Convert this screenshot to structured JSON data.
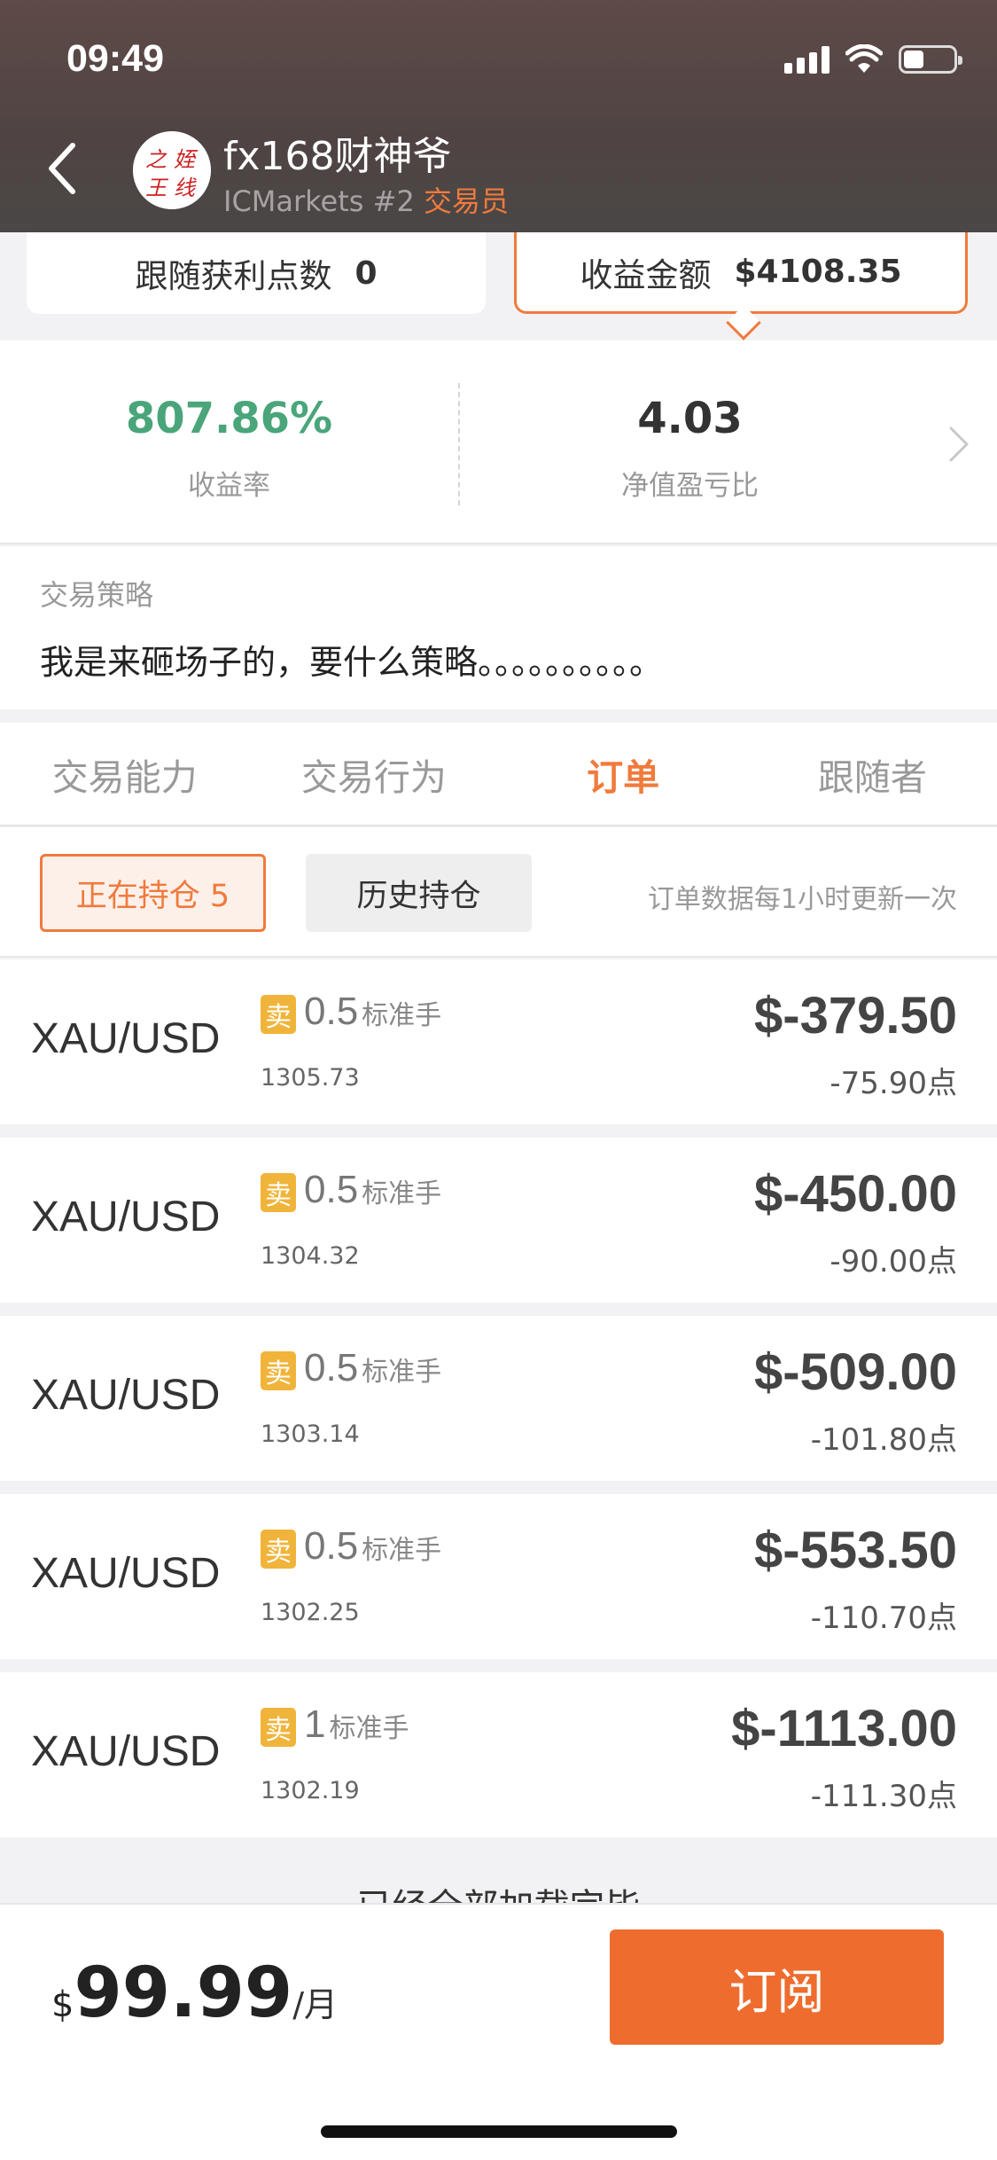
{
  "status_bar": {
    "time": "09:49"
  },
  "header": {
    "trader_name": "fx168财神爷",
    "broker": "ICMarkets #2",
    "role": "交易员",
    "avatar_text": "之 姪 王 线"
  },
  "summary": {
    "left_label": "跟随获利点数",
    "left_value": "0",
    "right_label": "收益金额",
    "right_value": "$4108.35"
  },
  "stats": [
    {
      "value": "807.86%",
      "label": "收益率"
    },
    {
      "value": "4.03",
      "label": "净值盈亏比"
    }
  ],
  "strategy": {
    "title": "交易策略",
    "text": "我是来砸场子的，要什么策略。。。。。。。。。。"
  },
  "tabs": [
    {
      "label": "交易能力",
      "active": false
    },
    {
      "label": "交易行为",
      "active": false
    },
    {
      "label": "订单",
      "active": true
    },
    {
      "label": "跟随者",
      "active": false
    }
  ],
  "filters": {
    "open_label": "正在持仓 5",
    "history_label": "历史持仓",
    "update_note": "订单数据每1小时更新一次"
  },
  "orders": [
    {
      "symbol": "XAU/USD",
      "side": "卖",
      "lots": "0.5",
      "unit": "标准手",
      "price": "1305.73",
      "pnl": "$-379.50",
      "points": "-75.90点"
    },
    {
      "symbol": "XAU/USD",
      "side": "卖",
      "lots": "0.5",
      "unit": "标准手",
      "price": "1304.32",
      "pnl": "$-450.00",
      "points": "-90.00点"
    },
    {
      "symbol": "XAU/USD",
      "side": "卖",
      "lots": "0.5",
      "unit": "标准手",
      "price": "1303.14",
      "pnl": "$-509.00",
      "points": "-101.80点"
    },
    {
      "symbol": "XAU/USD",
      "side": "卖",
      "lots": "0.5",
      "unit": "标准手",
      "price": "1302.25",
      "pnl": "$-553.50",
      "points": "-110.70点"
    },
    {
      "symbol": "XAU/USD",
      "side": "卖",
      "lots": "1",
      "unit": "标准手",
      "price": "1302.19",
      "pnl": "$-1113.00",
      "points": "-111.30点"
    }
  ],
  "loaded_hint": "已经全部加载完毕",
  "subscription": {
    "currency": "$",
    "amount": "99.99",
    "period": "/月",
    "button_label": "订阅"
  },
  "colors": {
    "accent": "#f07a3c",
    "gain_green": "#4aa57a",
    "sell_badge": "#f0b43a"
  },
  "icons": {
    "back": "chevron-left-icon",
    "stats_more": "chevron-right-icon",
    "signal": "cellular-signal-icon",
    "wifi": "wifi-icon",
    "battery": "battery-icon"
  }
}
